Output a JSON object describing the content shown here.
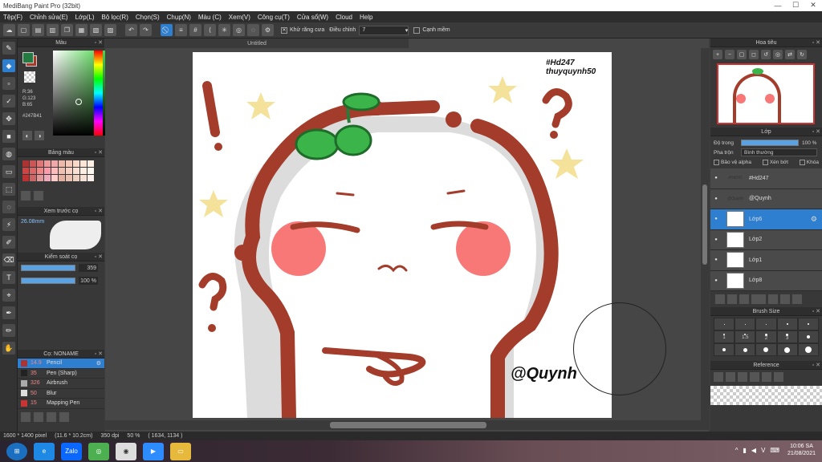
{
  "window": {
    "title": "MediBang Paint Pro (32bit)",
    "controls": [
      "—",
      "☐",
      "✕"
    ]
  },
  "menu": [
    "Tệp(F)",
    "Chỉnh sửa(E)",
    "Lớp(L)",
    "Bộ lọc(R)",
    "Chọn(S)",
    "Chụp(N)",
    "Màu (C)",
    "Xem(V)",
    "Công cụ(T)",
    "Cửa sổ(W)",
    "Cloud",
    "Help"
  ],
  "toolbar": {
    "antialias_label": "Khử răng cưa",
    "correction_label": "Điều chỉnh",
    "correction_value": "7",
    "snap_label": "Cạnh mềm"
  },
  "left": {
    "color_header": "Màu",
    "rgb_r": "R:36",
    "rgb_g": "G:123",
    "rgb_b": "B:65",
    "hex": "#247B41",
    "palette_header": "Bảng màu",
    "palette_colors": [
      "#a33",
      "#c55",
      "#d77",
      "#e99",
      "#eaa",
      "#f0b8a8",
      "#f4c8b8",
      "#f8d8c8",
      "#fbe6d8",
      "#fff0e6",
      "#c44",
      "#d66",
      "#e88",
      "#f9a",
      "#fbb",
      "#f2c0b0",
      "#f6d0c0",
      "#fae0d0",
      "#fceee2",
      "#fff6ee",
      "#b33",
      "#c66",
      "#d99",
      "#eab",
      "#fcc",
      "#e6b0a0",
      "#eac0b0",
      "#eed0c0",
      "#f4e0d4",
      "#faeee8"
    ],
    "preview_header": "Xem trước cọ",
    "preview_size": "26.08mm",
    "control_header": "Kiểm soát cọ",
    "size_value": "359",
    "opacity_value": "100 %",
    "brush_header": "Cọ: NONAME",
    "brushes": [
      {
        "size": "14.9",
        "name": "Pencil",
        "color": "#a33"
      },
      {
        "size": "35",
        "name": "Pen (Sharp)",
        "color": "#222"
      },
      {
        "size": "326",
        "name": "Airbrush",
        "color": "#aaa"
      },
      {
        "size": "50",
        "name": "Blur",
        "color": "#ddd"
      },
      {
        "size": "15",
        "name": "Mapping Pen",
        "color": "#c33"
      }
    ]
  },
  "canvas": {
    "tab_title": "Untitled",
    "text_top_1": "#Hd247",
    "text_top_2": "thuyquynh50",
    "signature": "@Quynh"
  },
  "right": {
    "navigator_header": "Hoa tiêu",
    "layer_header": "Lớp",
    "opacity_label": "Độ trong",
    "opacity_value": "100 %",
    "blend_label": "Pha trộn",
    "blend_value": "Bình thường",
    "protect_alpha": "Bảo vệ alpha",
    "clipping": "Xén bớt",
    "lock": "Khóa",
    "layers": [
      {
        "name": "#Hd247",
        "thumb_text": "#Hd247"
      },
      {
        "name": "@Quynh",
        "thumb_text": "@Quynh"
      },
      {
        "name": "Lớp6",
        "thumb_text": ""
      },
      {
        "name": "Lớp2",
        "thumb_text": ""
      },
      {
        "name": "Lớp1",
        "thumb_text": ""
      },
      {
        "name": "Lớp8",
        "thumb_text": ""
      }
    ],
    "brush_size_header": "Brush Size",
    "brush_sizes": [
      "1",
      "1.5",
      "2",
      "3"
    ],
    "reference_header": "Reference"
  },
  "status": {
    "dimensions": "1600 * 1400 pixel",
    "physical": "(11.6 * 10.2cm)",
    "dpi": "350 dpi",
    "zoom": "50 %",
    "coords": "( 1634, 1134 )"
  },
  "taskbar": {
    "time": "10:06 SA",
    "date": "21/08/2021"
  },
  "colors": {
    "accent": "#2f7fd0",
    "stroke": "#a33c2a",
    "leaf": "#3bb54a",
    "blush": "#f87878",
    "star": "#f5e29a"
  }
}
